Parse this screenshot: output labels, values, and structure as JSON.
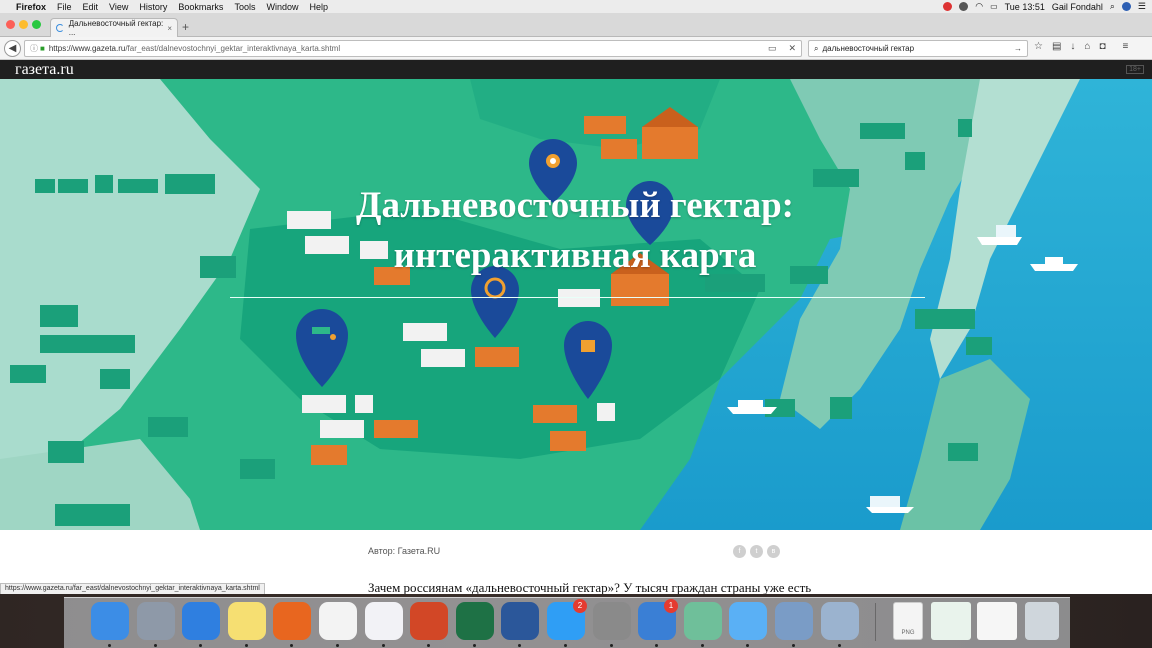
{
  "menubar": {
    "app": "Firefox",
    "items": [
      "File",
      "Edit",
      "View",
      "History",
      "Bookmarks",
      "Tools",
      "Window",
      "Help"
    ],
    "clock": "Tue 13:51",
    "user": "Gail Fondahl"
  },
  "browser": {
    "tab_title": "Дальневосточный гектар: ...",
    "url_host": "https://www.gazeta.ru",
    "url_path": "/far_east/dalnevostochnyi_gektar_interaktivnaya_karta.shtml",
    "search_value": "дальневосточный гектар",
    "status_url": "https://www.gazeta.ru/far_east/dalnevostochnyi_gektar_interaktivnaya_karta.shtml"
  },
  "site": {
    "logo": "газета.ru",
    "age_badge": "18+",
    "hero_title_line1": "Дальневосточный гектар:",
    "hero_title_line2": "интерактивная карта",
    "byline": "Автор: Газета.RU",
    "lead": "Зачем россиянам «дальневосточный гектар»? У тысяч граждан страны уже есть"
  },
  "colors": {
    "sea": "#1fa4cf",
    "land_dark": "#14a27a",
    "land_mid": "#2bb58a",
    "land_light": "#a7d8c9",
    "pin": "#1a4a9a",
    "house_orange": "#e47a2d"
  },
  "dock": {
    "apps": [
      {
        "name": "finder-icon",
        "color": "#3c8de6"
      },
      {
        "name": "launchpad-icon",
        "color": "#8e99a8"
      },
      {
        "name": "safari-icon",
        "color": "#2f7fe0"
      },
      {
        "name": "notes-icon",
        "color": "#f6df72"
      },
      {
        "name": "firefox-icon",
        "color": "#e8661f"
      },
      {
        "name": "photos-icon",
        "color": "#f3f3f3"
      },
      {
        "name": "itunes-icon",
        "color": "#f2f2f6"
      },
      {
        "name": "powerpoint-icon",
        "color": "#d24726"
      },
      {
        "name": "excel-icon",
        "color": "#1e7145"
      },
      {
        "name": "word-icon",
        "color": "#2b579a"
      },
      {
        "name": "app-store-icon",
        "color": "#2f9ef5"
      },
      {
        "name": "system-preferences-icon",
        "color": "#8a8a8a"
      },
      {
        "name": "outlook-icon",
        "color": "#3a7fd5"
      },
      {
        "name": "vpn-icon",
        "color": "#6fbf9a"
      },
      {
        "name": "messages-icon",
        "color": "#5ab0f5"
      },
      {
        "name": "preview-icon",
        "color": "#7a9cc6"
      },
      {
        "name": "image-capture-icon",
        "color": "#9bb3cf"
      }
    ],
    "appstore_badge": "2",
    "outlook_badge": "1",
    "png_label": "PNG"
  }
}
